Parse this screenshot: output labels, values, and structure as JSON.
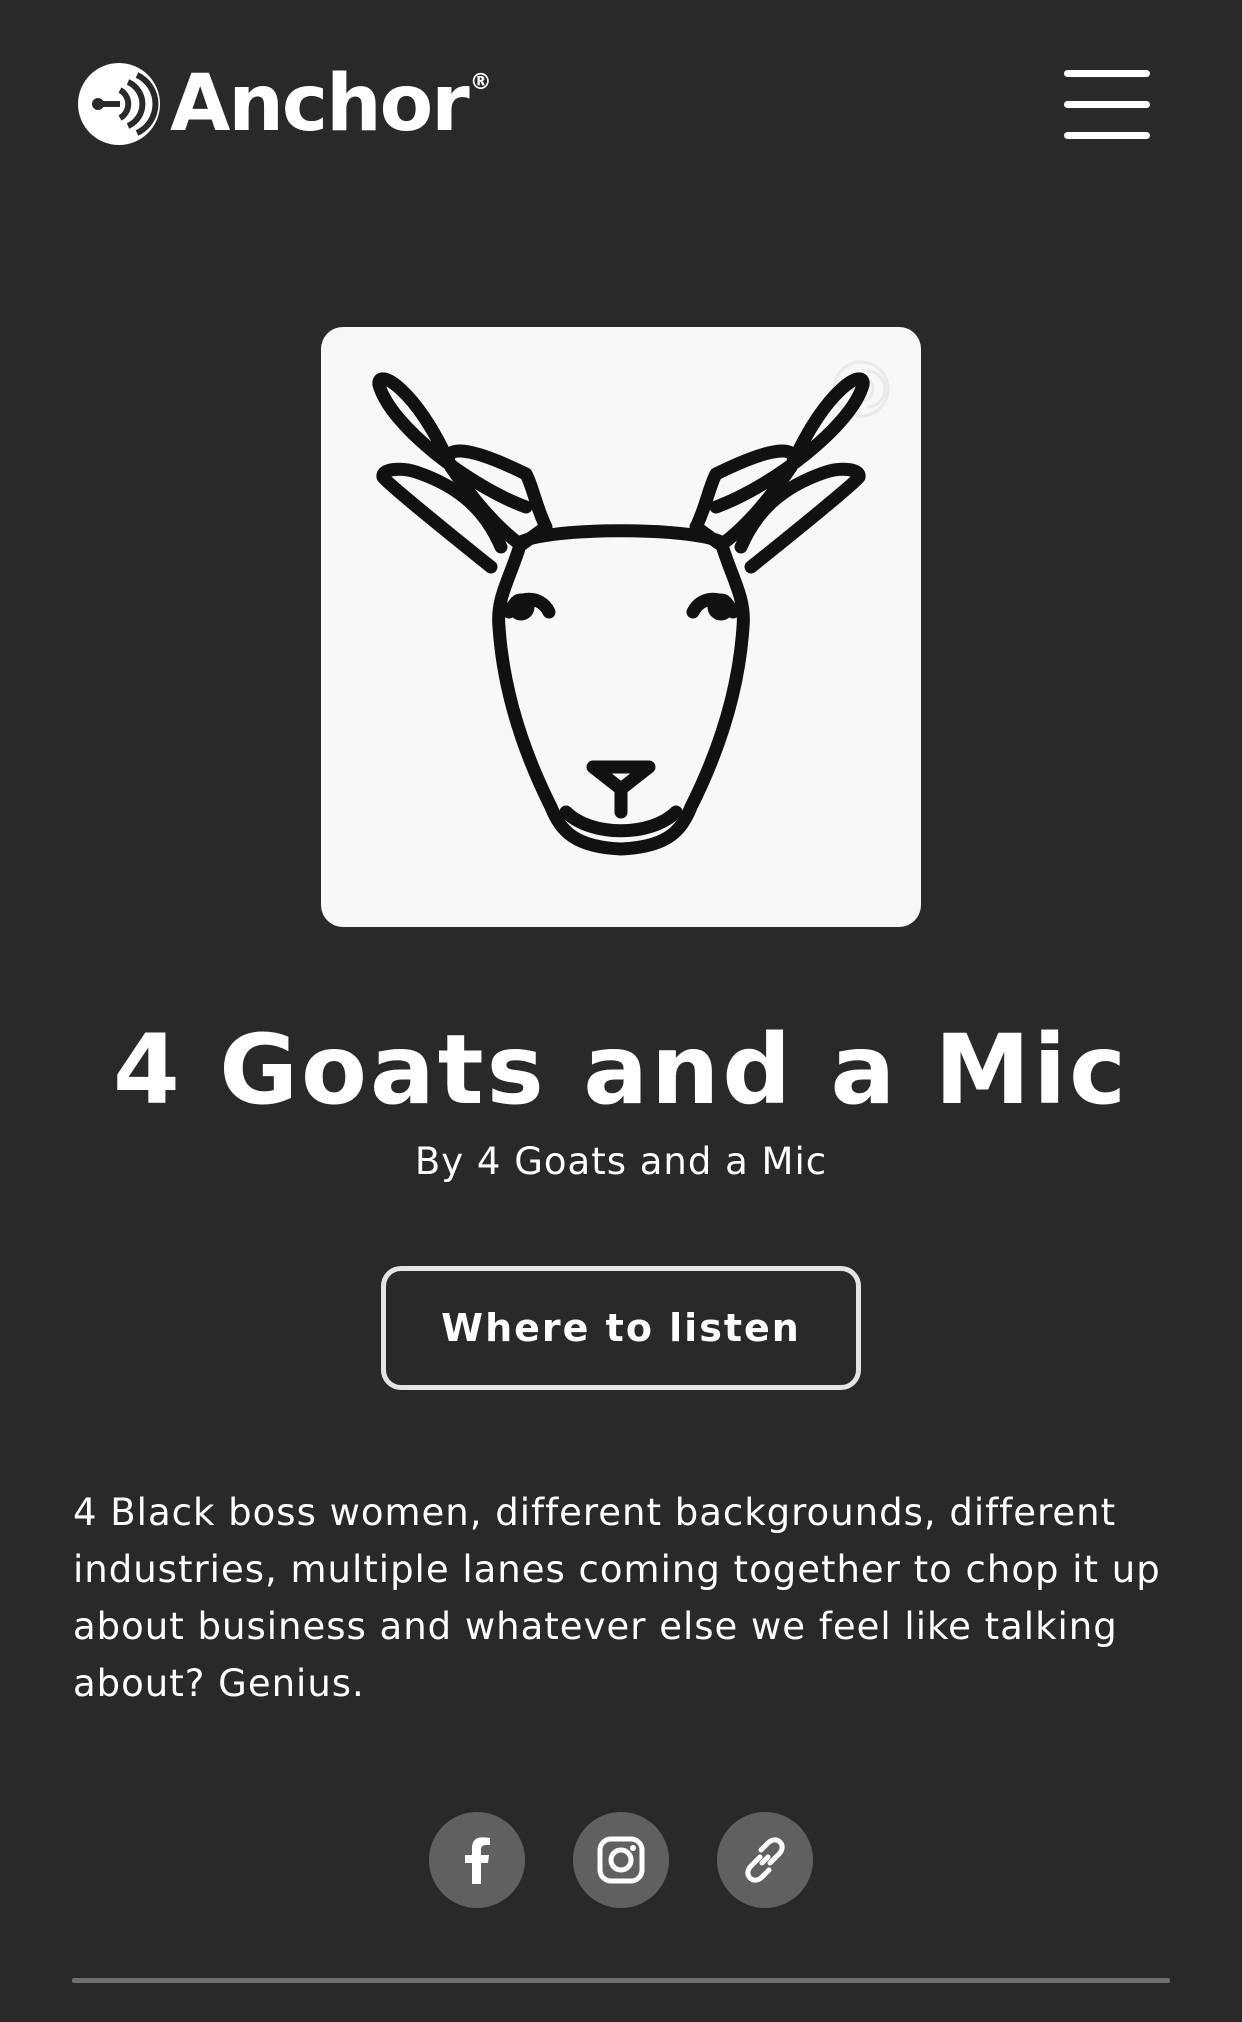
{
  "header": {
    "brand": "Anchor",
    "registered_mark": "®",
    "logo_icon": "anchor-logo-icon",
    "menu_icon": "hamburger-menu-icon"
  },
  "podcast": {
    "cover_icon": "goat-head-icon",
    "title": "4 Goats and a Mic",
    "author": "By 4 Goats and a Mic",
    "listen_button": "Where to listen",
    "description": "4 Black boss women, different backgrounds, different industries, multiple lanes coming together to chop it up about business and whatever else we feel like talking about? Genius."
  },
  "social": {
    "links": [
      {
        "icon": "facebook-icon"
      },
      {
        "icon": "instagram-icon"
      },
      {
        "icon": "link-icon"
      }
    ]
  },
  "colors": {
    "background": "#292929",
    "text": "#ffffff",
    "social_circle": "#606060",
    "cover_background": "#f8f8f8"
  }
}
